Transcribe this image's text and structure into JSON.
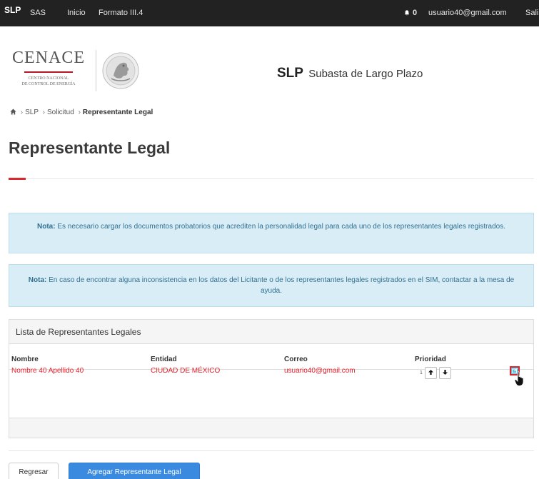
{
  "navbar": {
    "brand": "SLP",
    "links": [
      "SAS",
      "Inicio",
      "Formato III.4"
    ],
    "notification_count": "0",
    "user_email": "usuario40@gmail.com",
    "logout": "Sali"
  },
  "header": {
    "logo_word": "CENACE",
    "logo_sub1": "Centro Nacional",
    "logo_sub2": "de Control de Energía",
    "app_abbr": "SLP",
    "app_name": "Subasta de Largo Plazo"
  },
  "breadcrumb": {
    "items": [
      "SLP",
      "Solicitud"
    ],
    "current": "Representante Legal"
  },
  "page_title": "Representante Legal",
  "notes": [
    {
      "label": "Nota:",
      "text": "Es necesario cargar los documentos probatorios que acrediten la personalidad legal para cada uno de los representantes legales registrados."
    },
    {
      "label": "Nota:",
      "text": "En caso de encontrar alguna inconsistencia en los datos del Licitante o de los representantes legales registrados en el SIM, contactar a la mesa de ayuda."
    }
  ],
  "panel": {
    "title": "Lista de Representantes Legales",
    "columns": [
      "Nombre",
      "Entidad",
      "Correo",
      "Prioridad"
    ],
    "rows": [
      {
        "nombre": "Nombre 40 Apellido 40",
        "entidad": "CIUDAD DE MÉXICO",
        "correo": "usuario40@gmail.com",
        "prioridad": "1"
      }
    ]
  },
  "buttons": {
    "back": "Regresar",
    "add": "Agregar Representante Legal"
  },
  "icons": {
    "bell": "bell-icon",
    "home": "home-icon",
    "up": "arrow-up-icon",
    "down": "arrow-down-icon",
    "edit": "edit-icon",
    "cursor": "hand-pointer-icon",
    "seal": "mexico-seal-icon"
  },
  "colors": {
    "navbar": "#222222",
    "accent_red": "#d9272e",
    "info_bg": "#d9edf7",
    "info_text": "#31708f",
    "primary_blue": "#3a8be0",
    "edit_button": "#5bc0de"
  }
}
